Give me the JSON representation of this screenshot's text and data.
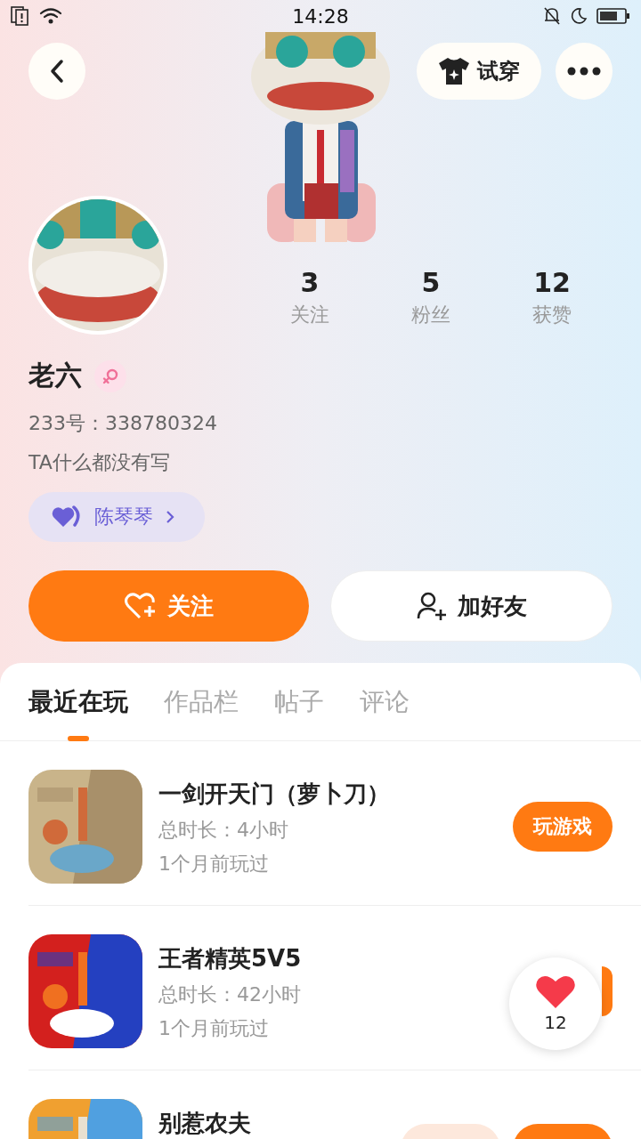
{
  "status_bar": {
    "time": "14:28"
  },
  "top_bar": {
    "try_on": "试穿"
  },
  "profile": {
    "name": "老六",
    "female": true,
    "id": "233号：338780324",
    "bio": "TA什么都没有写",
    "relation": {
      "name": "陈琴琴"
    }
  },
  "stats": [
    {
      "value": "3",
      "label": "关注"
    },
    {
      "value": "5",
      "label": "粉丝"
    },
    {
      "value": "12",
      "label": "获赞"
    }
  ],
  "actions": [
    {
      "kind": "primary",
      "label": "关注"
    },
    {
      "kind": "secondary",
      "label": "加好友"
    }
  ],
  "tabs": [
    {
      "label": "最近在玩",
      "selected": true
    },
    {
      "label": "作品栏",
      "selected": false
    },
    {
      "label": "帖子",
      "selected": false
    },
    {
      "label": "评论",
      "selected": false
    }
  ],
  "games": [
    {
      "title": "一剑开天门（萝卜刀）",
      "duration": "总时长：4小时",
      "last_played": "1个月前玩过",
      "buttons": [
        {
          "kind": "play",
          "label": "玩游戏"
        }
      ]
    },
    {
      "title": "王者精英5V5",
      "duration": "总时长：42小时",
      "last_played": "1个月前玩过",
      "buttons": [
        {
          "kind": "stub"
        }
      ]
    },
    {
      "title": "别惹农夫",
      "buttons": [
        {
          "kind": "secondary"
        },
        {
          "kind": "play"
        }
      ]
    }
  ],
  "like_bubble": {
    "count": "12"
  }
}
